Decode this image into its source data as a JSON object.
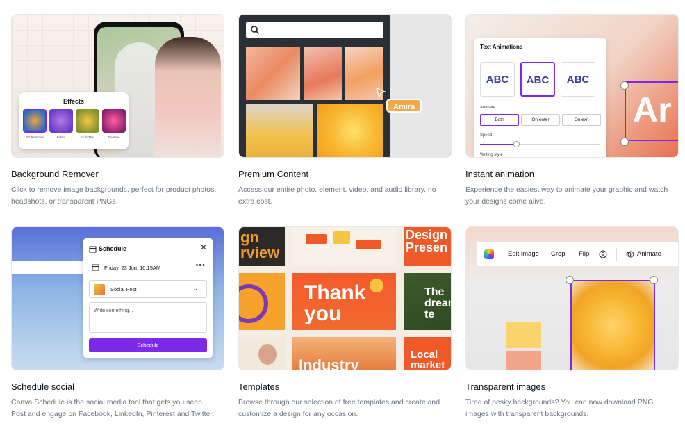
{
  "cards": [
    {
      "title": "Background Remover",
      "description": "Click to remove image backgrounds, perfect for product photos, headshots, or transparent PNGs.",
      "panel": {
        "title": "Effects",
        "items": [
          {
            "label": "BG Remover"
          },
          {
            "label": "Filters"
          },
          {
            "label": "ColorMix"
          },
          {
            "label": "Duotone"
          }
        ]
      }
    },
    {
      "title": "Premium Content",
      "description": "Access our entire photo, element, video, and audio library, no extra cost.",
      "cursor_name": "Amira"
    },
    {
      "title": "Instant animation",
      "description": "Experience the easiest way to animate your graphic and watch your designs come alive.",
      "panel": {
        "title": "Text Animations",
        "samples": [
          "ABC",
          "ABC",
          "ABC"
        ],
        "animate_label": "Animate",
        "options": [
          "Both",
          "On enter",
          "On exit"
        ],
        "speed_label": "Speed",
        "writing_label": "Writing style",
        "preview_text": "Ar"
      }
    },
    {
      "title": "Schedule social",
      "description": "Canva Schedule is the social media tool that gets you seen. Post and engage on Facebook, LinkedIn, Pinterest and Twitter.",
      "panel": {
        "title": "Schedule",
        "date": "Friday, 23 Jun, 10:15AM",
        "channel": "Social Post",
        "placeholder": "Write something...",
        "button": "Schedule"
      }
    },
    {
      "title": "Templates",
      "description": "Browse through our selection of free templates and create and customize a design for any occasion.",
      "thumb_texts": {
        "t1": "gn\nrview",
        "t2": "Thank\nyou",
        "t3": "Design\nPresen",
        "t4": "The\ndream\nte",
        "t5": "Industry",
        "t6": "Local\nmarket"
      }
    },
    {
      "title": "Transparent images",
      "description": "Tired of pesky backgrounds? You can now download PNG images with transparent backgrounds.",
      "toolbar": {
        "edit": "Edit image",
        "crop": "Crop",
        "flip": "Flip",
        "animate": "Animate"
      }
    }
  ],
  "colors": {
    "accent": "#7d2ae8",
    "title": "#0d1216",
    "description": "#6b7280"
  }
}
